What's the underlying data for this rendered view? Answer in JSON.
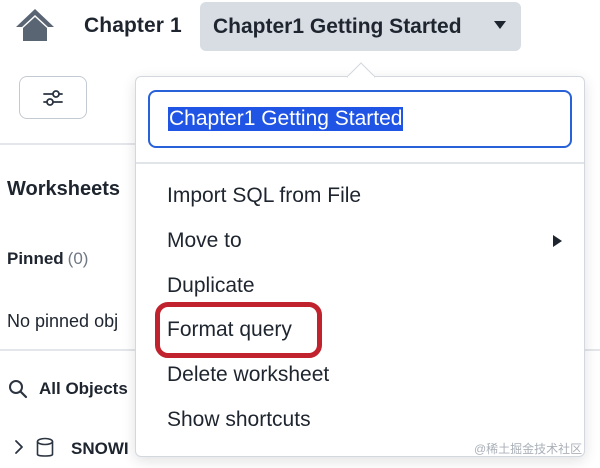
{
  "header": {
    "home_icon": "home-icon",
    "breadcrumb": "Chapter 1",
    "worksheet_title": "Chapter1 Getting Started",
    "title_caret_icon": "caret-down-icon"
  },
  "sidebar": {
    "filter_icon": "sliders-icon",
    "worksheets_heading": "Worksheets",
    "pinned_label": "Pinned",
    "pinned_count": "(0)",
    "no_pinned_text": "No pinned obj",
    "all_objects_label": "All Objects",
    "database_item": "SNOWI"
  },
  "menu": {
    "name_input_value": "Chapter1 Getting Started",
    "items": [
      {
        "label": "Import SQL from File"
      },
      {
        "label": "Move to",
        "has_submenu": true
      },
      {
        "label": "Duplicate"
      },
      {
        "label": "Format query",
        "highlighted": true
      },
      {
        "label": "Delete worksheet"
      },
      {
        "label": "Show shortcuts"
      }
    ]
  },
  "annotation": {
    "highlight_color": "#c0232d"
  },
  "watermark": "@稀土掘金技术社区",
  "colors": {
    "accent": "#2961d8",
    "selection": "#1f54e5",
    "title_button_bg": "#d8dde3"
  }
}
